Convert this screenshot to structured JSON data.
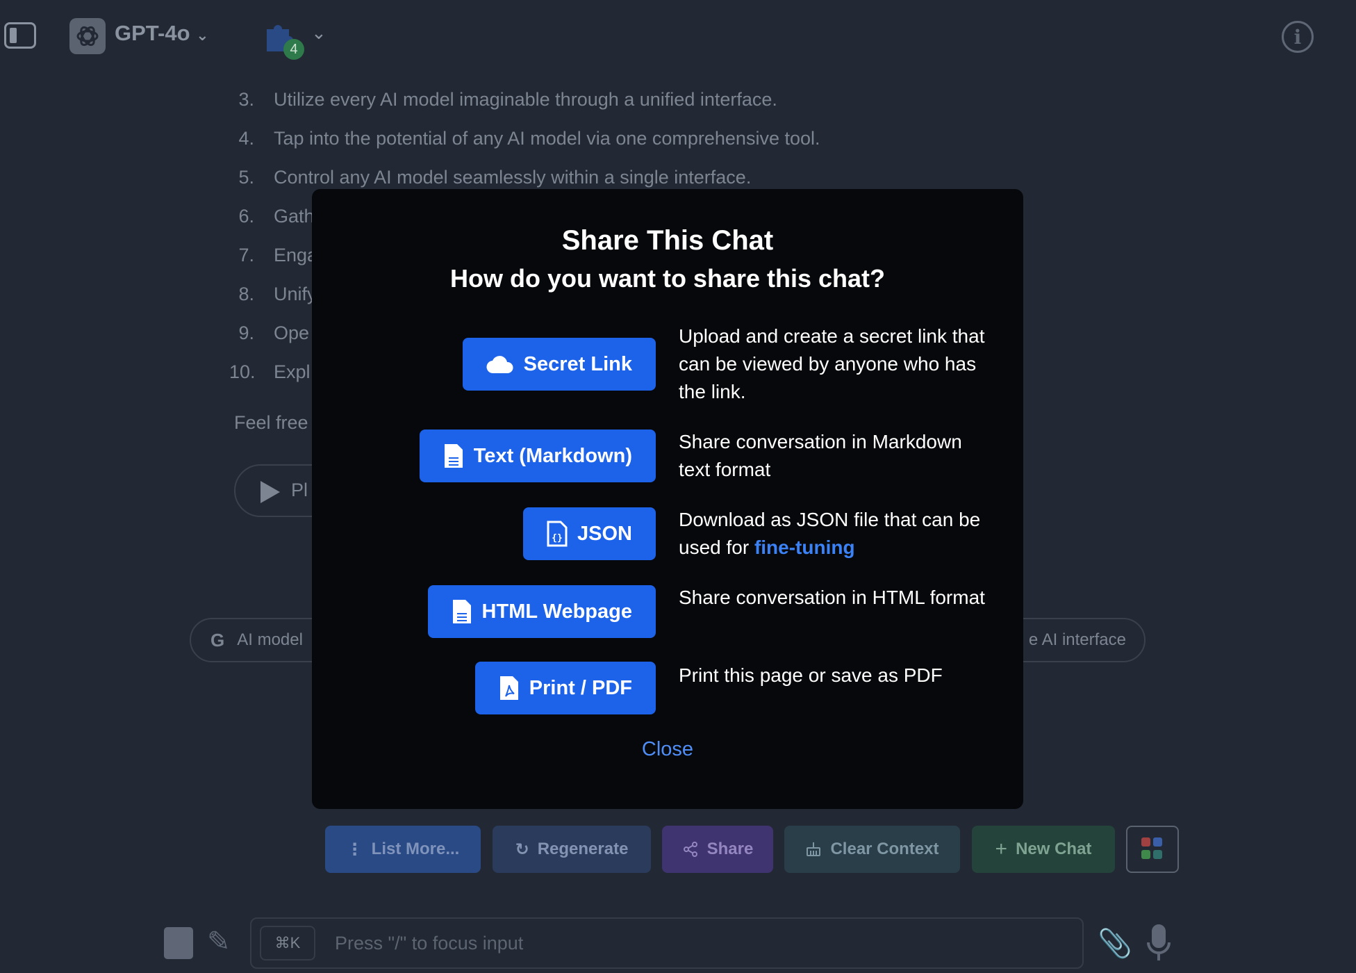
{
  "header": {
    "model_name": "GPT-4o",
    "plugin_count": "4",
    "info_glyph": "i"
  },
  "background": {
    "list": [
      {
        "num": "3.",
        "text": "Utilize every AI model imaginable through a unified interface."
      },
      {
        "num": "4.",
        "text": "Tap into the potential of any AI model via one comprehensive tool."
      },
      {
        "num": "5.",
        "text": "Control any AI model seamlessly within a single interface."
      },
      {
        "num": "6.",
        "text": "Gath"
      },
      {
        "num": "7.",
        "text": "Enga"
      },
      {
        "num": "8.",
        "text": "Unify"
      },
      {
        "num": "9.",
        "text": "Ope"
      },
      {
        "num": "10.",
        "text": "Expl"
      }
    ],
    "feel_free": "Feel free",
    "play_label": "Pl",
    "chip_left": "AI model",
    "chip_right": "e AI interface",
    "google_letter": "G"
  },
  "actions": {
    "list_more": "List More...",
    "regenerate": "Regenerate",
    "share": "Share",
    "clear_context": "Clear Context",
    "new_chat": "New Chat"
  },
  "input": {
    "shortcut": "⌘K",
    "placeholder": "Press \"/\" to focus input"
  },
  "modal": {
    "title": "Share This Chat",
    "subtitle": "How do you want to share this chat?",
    "options": {
      "secret_link": {
        "label": "Secret Link",
        "desc": "Upload and create a secret link that can be viewed by anyone who has the link."
      },
      "markdown": {
        "label": "Text (Markdown)",
        "desc": "Share conversation in Markdown text format"
      },
      "json": {
        "label": "JSON",
        "desc_prefix": "Download as JSON file that can be used for ",
        "desc_link": "fine-tuning"
      },
      "html": {
        "label": "HTML Webpage",
        "desc": "Share conversation in HTML format"
      },
      "pdf": {
        "label": "Print / PDF",
        "desc": "Print this page or save as PDF"
      }
    },
    "close": "Close"
  },
  "colors": {
    "primary_button": "#1d63ea",
    "link": "#3b82f6",
    "modal_bg": "#07080b",
    "page_bg": "#222934"
  }
}
